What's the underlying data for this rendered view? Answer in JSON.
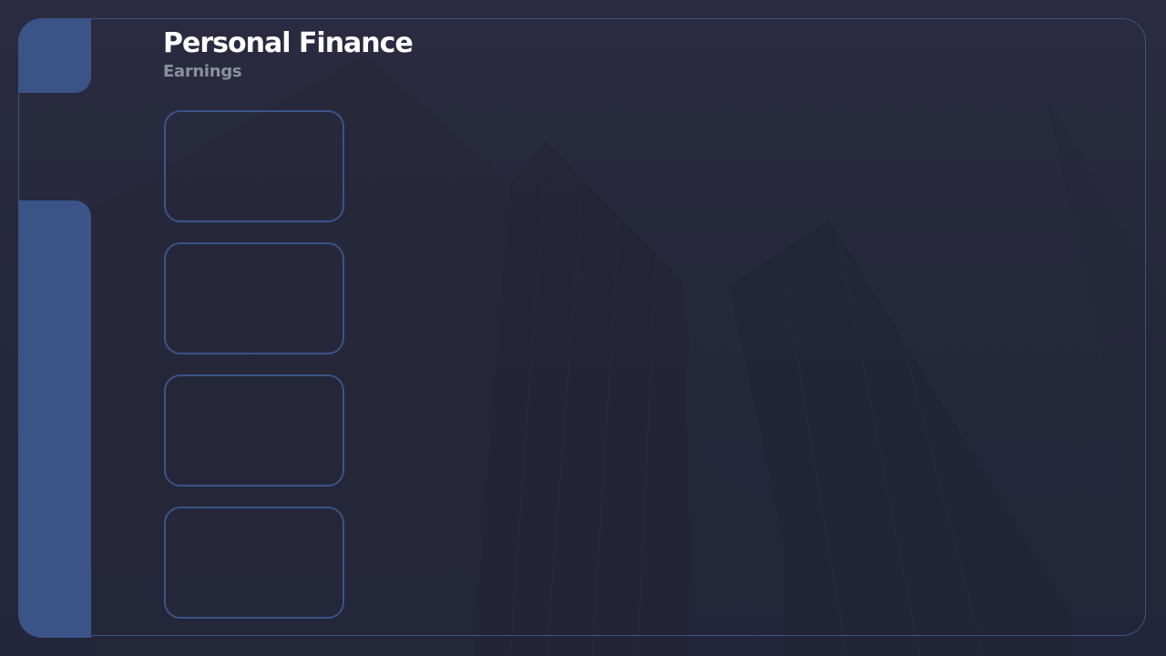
{
  "header": {
    "title": "Personal Finance",
    "subtitle": "Earnings"
  },
  "cards": [
    {
      "label": ""
    },
    {
      "label": ""
    },
    {
      "label": ""
    },
    {
      "label": ""
    }
  ],
  "colors": {
    "background": "#282a3e",
    "accent": "#3a5487",
    "border": "#3a5488",
    "title": "#ffffff",
    "subtitle": "#8b8fa0"
  }
}
